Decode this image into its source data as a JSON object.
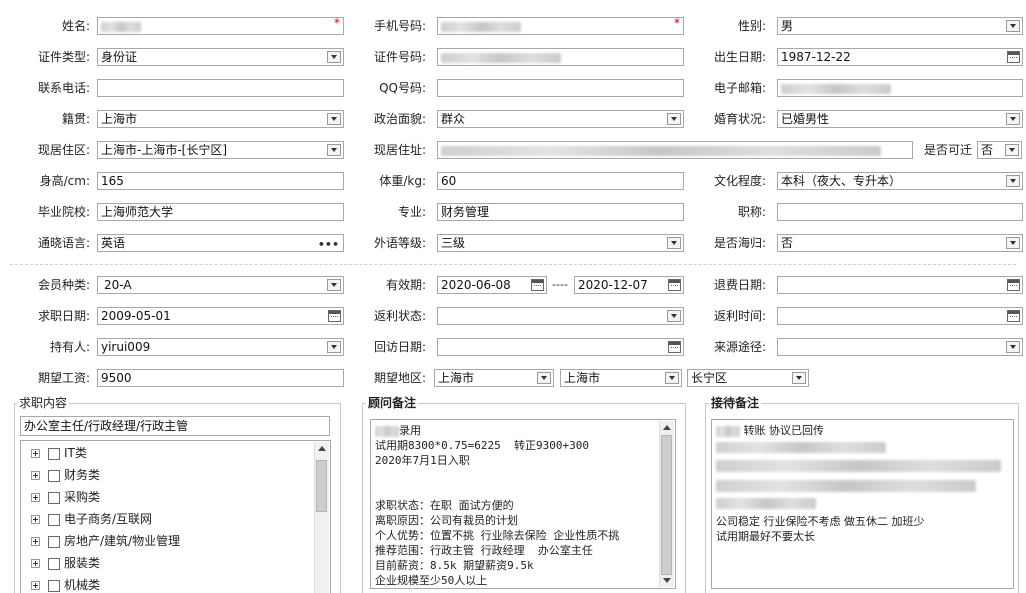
{
  "labels": {
    "name": "姓名:",
    "mobile": "手机号码:",
    "gender": "性别:",
    "id_type": "证件类型:",
    "id_no": "证件号码:",
    "birth": "出生日期:",
    "phone": "联系电话:",
    "qq": "QQ号码:",
    "email": "电子邮箱:",
    "native": "籍贯:",
    "political": "政治面貌:",
    "marital": "婚育状况:",
    "residence_area": "现居住区:",
    "residence_addr": "现居住址:",
    "relocate": "是否可迁",
    "height": "身高/cm:",
    "weight": "体重/kg:",
    "education": "文化程度:",
    "school": "毕业院校:",
    "major": "专业:",
    "title": "职称:",
    "language": "通晓语言:",
    "foreign_level": "外语等级:",
    "overseas": "是否海归:",
    "member_type": "会员种类:",
    "valid_period": "有效期:",
    "refund_date": "退费日期:",
    "job_date": "求职日期:",
    "rebate_status": "返利状态:",
    "rebate_time": "返利时间:",
    "holder": "持有人:",
    "visit_date": "回访日期:",
    "source": "来源途径:",
    "salary": "期望工资:",
    "region": "期望地区:"
  },
  "values": {
    "gender": "男",
    "id_type": "身份证",
    "birth": "1987-12-22",
    "native": "上海市",
    "political": "群众",
    "marital": "已婚男性",
    "residence_area": "上海市-上海市-[长宁区]",
    "relocate": "否",
    "height": "165",
    "weight": "60",
    "education": "本科（夜大、专升本）",
    "school": "上海师范大学",
    "major": "财务管理",
    "language": "英语",
    "foreign_level": "三级",
    "overseas": "否",
    "member_type": "20-A",
    "valid_from": "2020-06-08",
    "valid_sep": "----",
    "valid_to": "2020-12-07",
    "job_date": "2009-05-01",
    "holder": "yirui009",
    "salary": "9500",
    "region_province": "上海市",
    "region_city": "上海市",
    "region_district": "长宁区"
  },
  "job_panel": {
    "title": "求职内容",
    "selected": "办公室主任/行政经理/行政主管",
    "categories": [
      "IT类",
      "财务类",
      "采购类",
      "电子商务/互联网",
      "房地产/建筑/物业管理",
      "服装类",
      "机械类"
    ]
  },
  "consultant_panel": {
    "title": "顾问备注",
    "lines": [
      "录用",
      "试用期8300*0.75=6225  转正9300+300",
      "2020年7月1日入职",
      "",
      "",
      "求职状态：在职 面试方便的",
      "离职原因：公司有裁员的计划",
      "个人优势：位置不挑 行业除去保险 企业性质不挑",
      "推荐范围：行政主管 行政经理  办公室主任",
      "目前薪资：8.5k 期望薪资9.5k",
      "企业规模至少50人以上"
    ]
  },
  "reception_panel": {
    "title": "接待备注",
    "line1": "转账 协议已回传",
    "line2": "公司稳定 行业保险不考虑 做五休二 加班少",
    "line3": "试用期最好不要太长"
  },
  "colors": {
    "required": "#d40000",
    "border": "#a8a8a8"
  }
}
